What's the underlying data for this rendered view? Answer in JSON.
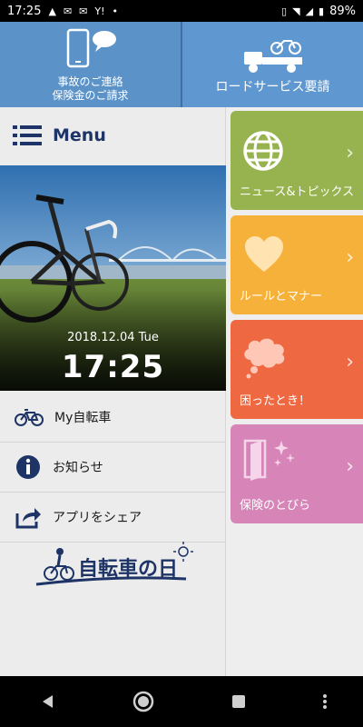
{
  "status_bar": {
    "time": "17:25",
    "battery": "89%"
  },
  "top_panel": {
    "accident_label_line1": "事故のご連絡",
    "accident_label_line2": "保険金のご請求",
    "road_service_label": "ロードサービス要請"
  },
  "menu": {
    "title": "Menu",
    "photo_date": "2018.12.04 Tue",
    "photo_time": "17:25",
    "items": [
      {
        "label": "My自転車"
      },
      {
        "label": "お知らせ"
      },
      {
        "label": "アプリをシェア"
      }
    ],
    "logo_text": "自転車の日"
  },
  "tiles": [
    {
      "label": "ニュース&トピックス",
      "color": "#97b34f"
    },
    {
      "label": "ルールとマナー",
      "color": "#f6b13a"
    },
    {
      "label": "困ったとき！",
      "color": "#ee6842"
    },
    {
      "label": "保険のとびら",
      "color": "#d785b8"
    }
  ],
  "accent": "#1e3466"
}
